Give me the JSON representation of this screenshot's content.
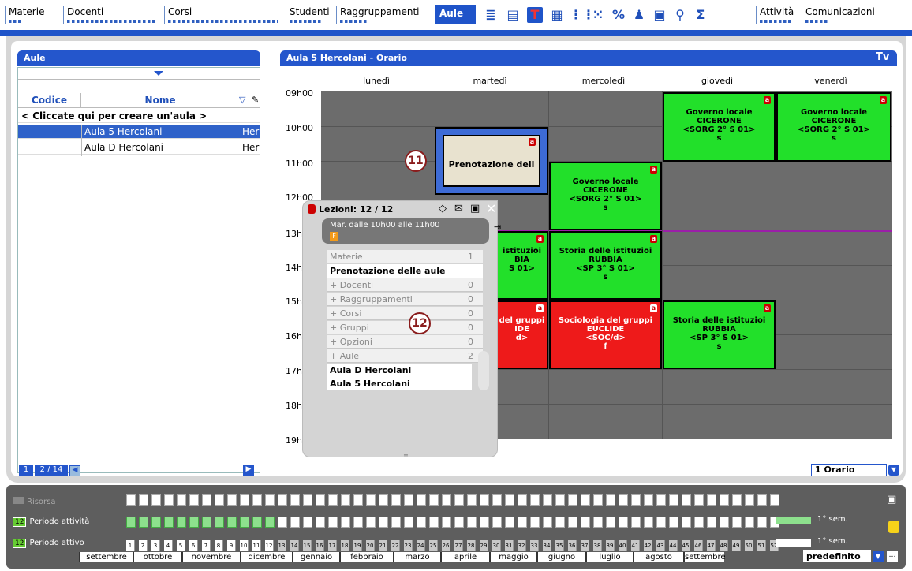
{
  "top_tabs": [
    "Materie",
    "Docenti",
    "Corsi",
    "Studenti",
    "Raggruppamenti",
    "Aule",
    "Attività",
    "Comunicazioni"
  ],
  "left_panel": {
    "title": "Aule",
    "col_code": "Codice",
    "col_name": "Nome",
    "create_row": "< Cliccate qui per creare un'aula >",
    "rows": [
      {
        "name": "Aula 5 Hercolani",
        "extra": "Her",
        "selected": true
      },
      {
        "name": "Aula D Hercolani",
        "extra": "Her",
        "selected": false
      }
    ],
    "pager_left": "1",
    "pager_right": "2 / 14"
  },
  "schedule": {
    "title": "Aula 5 Hercolani - Orario",
    "days": [
      "lunedì",
      "martedì",
      "mercoledì",
      "giovedì",
      "venerdì"
    ],
    "hours": [
      "09h00",
      "10h00",
      "11h00",
      "12h00",
      "13h0",
      "14h00",
      "15h00",
      "16h00",
      "17h00",
      "18h00",
      "19h00"
    ],
    "courses": [
      {
        "l1": "Governo locale",
        "l2": "CICERONE",
        "l3": "<SORG 2° S 01>",
        "l4": "s",
        "color": "green"
      },
      {
        "l1": "Governo locale",
        "l2": "CICERONE",
        "l3": "<SORG 2° S 01>",
        "l4": "s",
        "color": "green"
      },
      {
        "l1": "Governo locale",
        "l2": "CICERONE",
        "l3": "<SORG 2° S 01>",
        "l4": "s",
        "color": "green"
      },
      {
        "l1": "Prenotazione dell",
        "l2": "",
        "l3": "",
        "l4": "",
        "color": "beige"
      },
      {
        "l1": "istituzioi",
        "l2": "BIA",
        "l3": "S 01>",
        "l4": "",
        "color": "green"
      },
      {
        "l1": "Storia delle istituzioi",
        "l2": "RUBBIA",
        "l3": "<SP 3° S 01>",
        "l4": "s",
        "color": "green"
      },
      {
        "l1": "del gruppi",
        "l2": "IDE",
        "l3": "d>",
        "l4": "",
        "color": "red"
      },
      {
        "l1": "Sociologia del gruppi",
        "l2": "EUCLIDE",
        "l3": "<SOC/d>",
        "l4": "f",
        "color": "red"
      },
      {
        "l1": "Storia delle istituzioi",
        "l2": "RUBBIA",
        "l3": "<SP 3° S 01>",
        "l4": "s",
        "color": "green"
      }
    ],
    "view_select": "1 Orario",
    "badge_11": "11",
    "badge_12": "12"
  },
  "popup": {
    "title": "Lezioni: 12 / 12",
    "subtitle": "Mar. dalle 10h00 alle 11h00",
    "flag": "F",
    "rows": [
      {
        "label": "Materie",
        "count": "1"
      },
      {
        "label": "+ Docenti",
        "count": "0"
      },
      {
        "label": "+ Raggruppamenti",
        "count": "0"
      },
      {
        "label": "+ Corsi",
        "count": "0"
      },
      {
        "label": "+ Gruppi",
        "count": "0"
      },
      {
        "label": "+ Opzioni",
        "count": "0"
      },
      {
        "label": "+ Aule",
        "count": "2"
      }
    ],
    "materia": "Prenotazione delle aule",
    "aule": [
      "Aula D Hercolani",
      "Aula 5 Hercolani"
    ]
  },
  "bottom": {
    "risorsa": "Risorsa",
    "periodo_attivita_num": "12",
    "periodo_attivita": "Periodo attività",
    "periodo_attivo_num": "12",
    "periodo_attivo": "Periodo attivo",
    "sem1": "1° sem.",
    "sem2": "1° sem.",
    "months": [
      "settembre",
      "ottobre",
      "novembre",
      "dicembre",
      "gennaio",
      "febbraio",
      "marzo",
      "aprile",
      "maggio",
      "giugno",
      "luglio",
      "agosto",
      "settembre"
    ],
    "preset": "predefinito"
  }
}
